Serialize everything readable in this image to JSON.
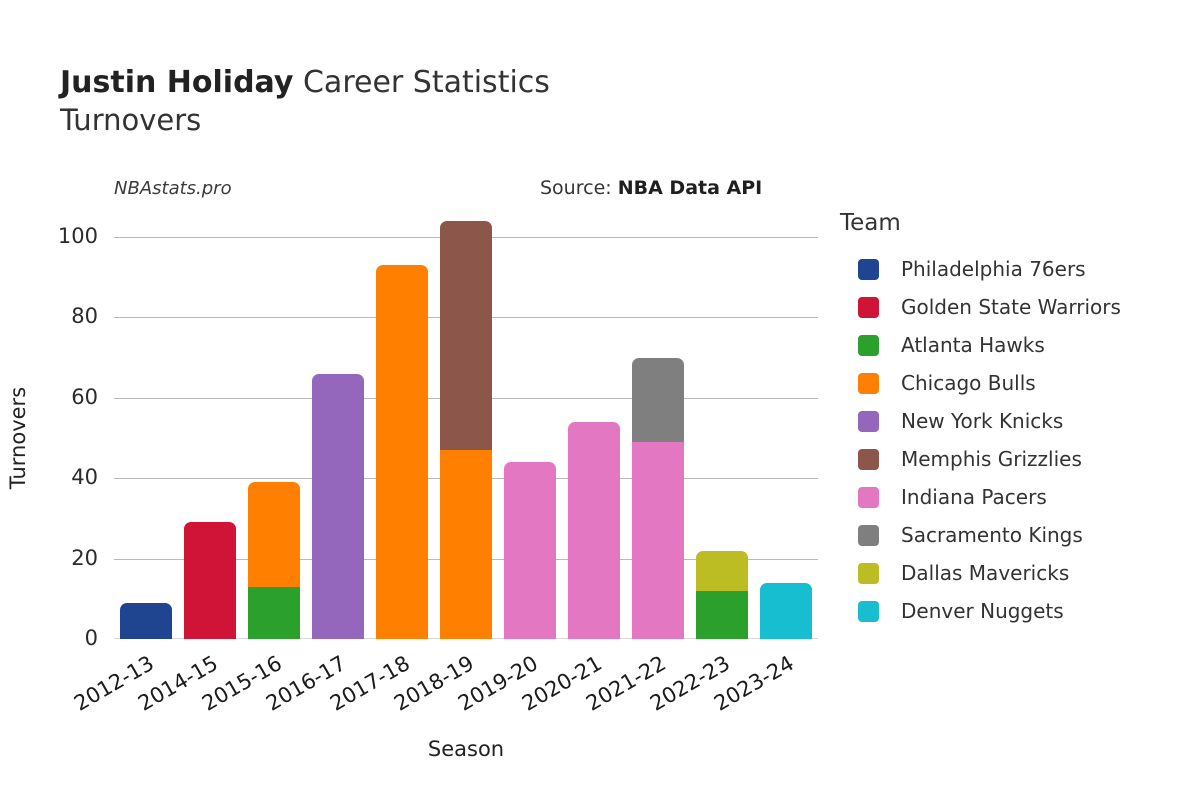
{
  "header": {
    "player_name": "Justin Holiday",
    "title_suffix": "Career Statistics",
    "stat_name": "Turnovers",
    "watermark": "NBAstats.pro",
    "source_label": "Source:",
    "source_value": "NBA Data API"
  },
  "legend": {
    "title": "Team"
  },
  "chart_data": {
    "type": "bar",
    "stacked": true,
    "title": "Justin Holiday Career Statistics — Turnovers",
    "xlabel": "Season",
    "ylabel": "Turnovers",
    "ylim": [
      0,
      100
    ],
    "yticks": [
      0,
      20,
      40,
      60,
      80,
      100
    ],
    "grid": true,
    "legend_position": "right",
    "categories": [
      "2012-13",
      "2014-15",
      "2015-16",
      "2016-17",
      "2017-18",
      "2018-19",
      "2019-20",
      "2020-21",
      "2021-22",
      "2022-23",
      "2023-24"
    ],
    "series": [
      {
        "name": "Philadelphia 76ers",
        "color": "#1f4490",
        "values": [
          9,
          0,
          0,
          0,
          0,
          0,
          0,
          0,
          0,
          0,
          0
        ]
      },
      {
        "name": "Golden State Warriors",
        "color": "#cf1437",
        "values": [
          0,
          29,
          0,
          0,
          0,
          0,
          0,
          0,
          0,
          0,
          0
        ]
      },
      {
        "name": "Atlanta Hawks",
        "color": "#2ca02c",
        "values": [
          0,
          0,
          13,
          0,
          0,
          0,
          0,
          0,
          0,
          12,
          0
        ]
      },
      {
        "name": "Chicago Bulls",
        "color": "#ff8000",
        "values": [
          0,
          0,
          26,
          0,
          93,
          47,
          0,
          0,
          0,
          0,
          0
        ]
      },
      {
        "name": "New York Knicks",
        "color": "#9467bd",
        "values": [
          0,
          0,
          0,
          66,
          0,
          0,
          0,
          0,
          0,
          0,
          0
        ]
      },
      {
        "name": "Memphis Grizzlies",
        "color": "#8c564b",
        "values": [
          0,
          0,
          0,
          0,
          0,
          57,
          0,
          0,
          0,
          0,
          0
        ]
      },
      {
        "name": "Indiana Pacers",
        "color": "#e377c2",
        "values": [
          0,
          0,
          0,
          0,
          0,
          0,
          44,
          54,
          49,
          0,
          0
        ]
      },
      {
        "name": "Sacramento Kings",
        "color": "#7f7f7f",
        "values": [
          0,
          0,
          0,
          0,
          0,
          0,
          0,
          0,
          21,
          0,
          0
        ]
      },
      {
        "name": "Dallas Mavericks",
        "color": "#bcbd22",
        "values": [
          0,
          0,
          0,
          0,
          0,
          0,
          0,
          0,
          0,
          10,
          0
        ]
      },
      {
        "name": "Denver Nuggets",
        "color": "#17becf",
        "values": [
          0,
          0,
          0,
          0,
          0,
          0,
          0,
          0,
          0,
          0,
          14
        ]
      }
    ],
    "totals": [
      9,
      29,
      39,
      66,
      93,
      104,
      44,
      54,
      70,
      22,
      14
    ]
  }
}
